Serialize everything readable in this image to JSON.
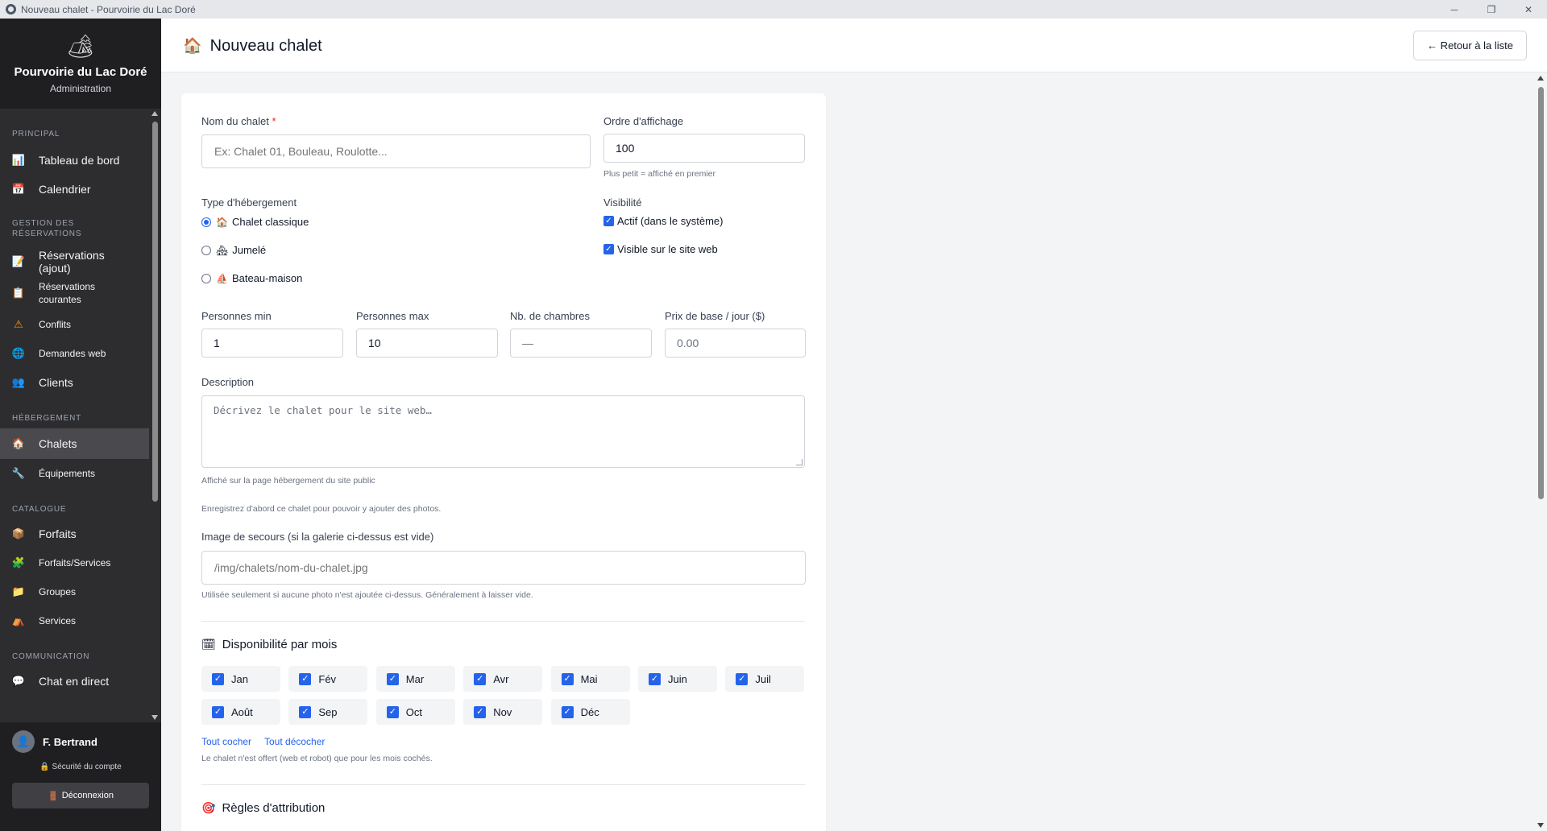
{
  "window": {
    "title": "Nouveau chalet - Pourvoirie du Lac Doré",
    "controls": {
      "minimize": "─",
      "maximize": "❐",
      "close": "✕"
    }
  },
  "brand": {
    "logo_glyph": "🏕",
    "name": "Pourvoirie du Lac Doré",
    "subtitle": "Administration"
  },
  "sidebar": {
    "sections": {
      "principal": "PRINCIPAL",
      "gestion": "GESTION DES RÉSERVATIONS",
      "hebergement": "HÉBERGEMENT",
      "catalogue": "CATALOGUE",
      "communication": "COMMUNICATION"
    },
    "items": {
      "dashboard": {
        "label": "Tableau de bord",
        "icon": "📊"
      },
      "calendar": {
        "label": "Calendrier",
        "icon": "📅"
      },
      "res_add": {
        "label": "Réservations (ajout)",
        "icon": "📝"
      },
      "res_current": {
        "label": "Réservations courantes",
        "icon": "📋"
      },
      "conflicts": {
        "label": "Conflits",
        "icon": "⚠"
      },
      "web_requests": {
        "label": "Demandes web",
        "icon": "🌐"
      },
      "clients": {
        "label": "Clients",
        "icon": "👥"
      },
      "chalets": {
        "label": "Chalets",
        "icon": "🏠"
      },
      "equipment": {
        "label": "Équipements",
        "icon": "🔧"
      },
      "packages": {
        "label": "Forfaits",
        "icon": "📦"
      },
      "packages_services": {
        "label": "Forfaits/Services",
        "icon": "🧩"
      },
      "groups": {
        "label": "Groupes",
        "icon": "📁"
      },
      "services": {
        "label": "Services",
        "icon": "⛺"
      },
      "chat": {
        "label": "Chat en direct",
        "icon": "💬"
      }
    }
  },
  "user": {
    "avatar_glyph": "👤",
    "name": "F. Bertrand",
    "security_icon": "🔒",
    "security_label": "Sécurité du compte",
    "logout_icon": "🚪",
    "logout_label": "Déconnexion"
  },
  "header": {
    "icon": "🏠",
    "title": "Nouveau chalet",
    "back_label": "← Retour à la liste"
  },
  "form": {
    "name": {
      "label": "Nom du chalet",
      "required_mark": "*",
      "placeholder": "Ex: Chalet 01, Bouleau, Roulotte..."
    },
    "order": {
      "label": "Ordre d'affichage",
      "value": "100",
      "hint": "Plus petit = affiché en premier"
    },
    "type": {
      "label": "Type d'hébergement",
      "options": [
        {
          "icon": "🏠",
          "label": "Chalet classique",
          "selected": true
        },
        {
          "icon": "🏘",
          "label": "Jumelé",
          "selected": false
        },
        {
          "icon": "⛵",
          "label": "Bateau-maison",
          "selected": false
        }
      ]
    },
    "visibility": {
      "label": "Visibilité",
      "active_label": "Actif (dans le système)",
      "web_label": "Visible sur le site web",
      "check_glyph": "✓"
    },
    "persons_min": {
      "label": "Personnes min",
      "value": "1"
    },
    "persons_max": {
      "label": "Personnes max",
      "value": "10"
    },
    "rooms": {
      "label": "Nb. de chambres",
      "placeholder": "—"
    },
    "price": {
      "label": "Prix de base / jour ($)",
      "placeholder": "0.00"
    },
    "description": {
      "label": "Description",
      "placeholder": "Décrivez le chalet pour le site web…",
      "hint": "Affiché sur la page hébergement du site public"
    },
    "photos_hint": "Enregistrez d'abord ce chalet pour pouvoir y ajouter des photos.",
    "fallback_image": {
      "label": "Image de secours (si la galerie ci-dessus est vide)",
      "placeholder": "/img/chalets/nom-du-chalet.jpg",
      "hint": "Utilisée seulement si aucune photo n'est ajoutée ci-dessus. Généralement à laisser vide."
    },
    "availability": {
      "icon": "🗓",
      "title": "Disponibilité par mois",
      "check_glyph": "✓",
      "months": [
        "Jan",
        "Fév",
        "Mar",
        "Avr",
        "Mai",
        "Juin",
        "Juil",
        "Août",
        "Sep",
        "Oct",
        "Nov",
        "Déc"
      ],
      "check_all": "Tout cocher",
      "uncheck_all": "Tout décocher",
      "hint": "Le chalet n'est offert (web et robot) que pour les mois cochés."
    },
    "rules": {
      "icon": "🎯",
      "title": "Règles d'attribution"
    }
  }
}
